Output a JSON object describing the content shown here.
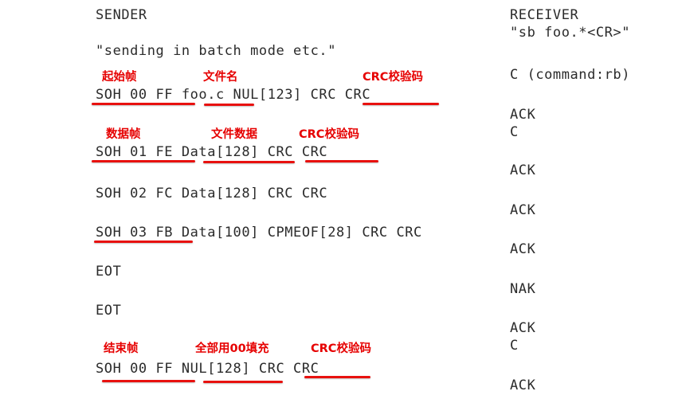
{
  "figure": {
    "kind": "xmodem-protocol-sequence-diagram",
    "accent_color": "#e8110f",
    "text_color": "#2b2b2b",
    "background_color": "#ffffff"
  },
  "sender": {
    "heading": "SENDER",
    "lines": [
      {
        "id": "batch-mode",
        "text": "\"sending in batch mode etc.\""
      },
      {
        "id": "header-frame",
        "text": "SOH 00 FF foo.c NUL[123] CRC CRC"
      },
      {
        "id": "data-frame-1",
        "text": "SOH 01 FE Data[128] CRC CRC"
      },
      {
        "id": "data-frame-2",
        "text": "SOH 02 FC Data[128] CRC CRC"
      },
      {
        "id": "data-frame-3",
        "text": "SOH 03 FB Data[100] CPMEOF[28] CRC CRC"
      },
      {
        "id": "eot-1",
        "text": "EOT"
      },
      {
        "id": "eot-2",
        "text": "EOT"
      },
      {
        "id": "end-frame",
        "text": "SOH 00 FF NUL[128] CRC CRC"
      }
    ]
  },
  "receiver": {
    "heading": "RECEIVER",
    "lines": [
      {
        "id": "command-line",
        "text": "\"sb foo.*<CR>\""
      },
      {
        "id": "c-command",
        "text": "C (command:rb)"
      },
      {
        "id": "ack-1",
        "text": "ACK"
      },
      {
        "id": "c-1",
        "text": "C"
      },
      {
        "id": "ack-2",
        "text": "ACK"
      },
      {
        "id": "ack-3",
        "text": "ACK"
      },
      {
        "id": "ack-4",
        "text": "ACK"
      },
      {
        "id": "nak-1",
        "text": "NAK"
      },
      {
        "id": "ack-5",
        "text": "ACK"
      },
      {
        "id": "c-2",
        "text": "C"
      },
      {
        "id": "ack-6",
        "text": "ACK"
      }
    ]
  },
  "annotations": [
    {
      "id": "start-frame-label",
      "text": "起始帧"
    },
    {
      "id": "filename-label",
      "text": "文件名"
    },
    {
      "id": "crc-label-header",
      "text": "CRC校验码"
    },
    {
      "id": "data-frame-label",
      "text": "数据帧"
    },
    {
      "id": "file-data-label",
      "text": "文件数据"
    },
    {
      "id": "crc-label-data",
      "text": "CRC校验码"
    },
    {
      "id": "end-frame-label",
      "text": "结束帧"
    },
    {
      "id": "zero-fill-label",
      "text": "全部用00填充"
    },
    {
      "id": "crc-label-end",
      "text": "CRC校验码"
    }
  ]
}
